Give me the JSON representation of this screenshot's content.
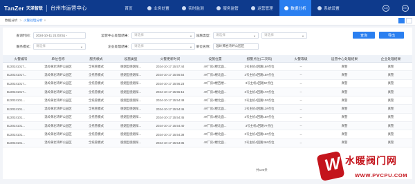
{
  "brand": {
    "logo": "TanZer",
    "sub": "天泽智联",
    "title": "台州市运营中心"
  },
  "nav": [
    {
      "label": "首页",
      "active": false
    },
    {
      "label": "业务处置",
      "active": false
    },
    {
      "label": "实时监测",
      "active": false
    },
    {
      "label": "服务监管",
      "active": false
    },
    {
      "label": "运营管理",
      "active": false
    },
    {
      "label": "数据分析",
      "active": true
    },
    {
      "label": "系统设置",
      "active": false
    }
  ],
  "nav_right": {
    "icon1": "AQ",
    "icon2": "ON"
  },
  "breadcrumb": {
    "root": "数据分析",
    "current": "火警处理分析"
  },
  "filters": {
    "query_time_label": "查询时间:",
    "query_time_value": "2024-10-11 21:03:51 -",
    "ops_center_label": "运营中心处理结果:",
    "ops_center_value": "请选择",
    "device_type_label": "设施类型:",
    "device_type_value": "请选择",
    "device_type_value2": "请选择",
    "service_mode_label": "服务模式:",
    "service_mode_value": "请选择",
    "enterprise_result_label": "企业处理结果:",
    "enterprise_result_value": "请选择",
    "unit_name_label": "单位名称:",
    "unit_name_value": "温岭黄岩湾畔公园区",
    "query_btn": "查询",
    "export_btn": "导出"
  },
  "table": {
    "headers": [
      "火警编号",
      "单位名称",
      "服务模式",
      "设施类型",
      "火警更新时间",
      "设施位置",
      "报警点位(二次码)",
      "火警等级",
      "运营中心处理结果",
      "企业处理结果"
    ],
    "rows": [
      [
        "BJ20241017...",
        "温岭黄岩湾畔公园区",
        "全托管模式",
        "感烟型感烟探...",
        "2024-10-17 15:57:44",
        "4#厂房4楼北面...",
        "3号主机4回路16#点位",
        "--",
        "真警",
        "真警"
      ],
      [
        "BJ20241017...",
        "温岭黄岩湾畔公园区",
        "全托管模式",
        "感烟型感烟探...",
        "2024-10-17 15:56:54",
        "4#厂房4楼北面...",
        "3号主机4回路15#点位",
        "--",
        "真警",
        "真警"
      ],
      [
        "BJ20241017...",
        "温岭黄岩湾畔公园区",
        "全托管模式",
        "感烟型感烟探...",
        "2024-10-17 15:56:23",
        "4#厂房3楼西楼...",
        "3号主机4回路5#点位",
        "--",
        "真警",
        "真警"
      ],
      [
        "BJ20241017...",
        "温岭黄岩湾畔公园区",
        "全托管模式",
        "感烟型感烟探...",
        "2024-10-17 15:55:16",
        "4#厂房4楼北面...",
        "3号主机4回路17#点位",
        "--",
        "真警",
        "真警"
      ],
      [
        "BJ2024101...",
        "温岭黄岩湾畔公园区",
        "全托管模式",
        "感烟型感烟探...",
        "2024-10-17 15:54:49",
        "4#厂房4楼北面...",
        "3号主机4回路10#点位",
        "--",
        "真警",
        "真警"
      ],
      [
        "BJ2024101...",
        "温岭黄岩湾畔公园区",
        "全托管模式",
        "感烟型感烟探...",
        "2024-10-17 15:54:46",
        "4#厂房4楼北面...",
        "3号主机4回路13#点位",
        "--",
        "真警",
        "真警"
      ],
      [
        "BJ2024101...",
        "温岭黄岩湾畔公园区",
        "全托管模式",
        "感烟型感烟探...",
        "2024-10-17 15:54:45",
        "4#厂房4楼北面...",
        "3号主机4回路15#点位",
        "--",
        "真警",
        "真警"
      ],
      [
        "BJ2024101...",
        "温岭黄岩湾畔公园区",
        "全托管模式",
        "感烟型感烟探...",
        "2024-10-17 15:54:40",
        "4#厂房4楼北面...",
        "3号主机4回路7#点位",
        "--",
        "真警",
        "真警"
      ],
      [
        "BJ2024101...",
        "温岭黄岩湾畔公园区",
        "全托管模式",
        "感烟型感烟探...",
        "2024-10-17 15:54:38",
        "4#厂房4楼北面...",
        "3号主机4回路12#点位",
        "--",
        "真警",
        "真警"
      ],
      [
        "BJ2024101...",
        "温岭黄岩湾畔公园区",
        "全托管模式",
        "感烟型感烟探...",
        "2024-10-17 15:54:35",
        "4#厂房4楼北面...",
        "3号主机4回路36#点位",
        "--",
        "真警",
        "真警"
      ]
    ]
  },
  "pagination": {
    "total": "共100条"
  },
  "watermark": {
    "logo": "W",
    "title": "水暖阀门网",
    "url": "WWW.PVCPU.COM"
  }
}
